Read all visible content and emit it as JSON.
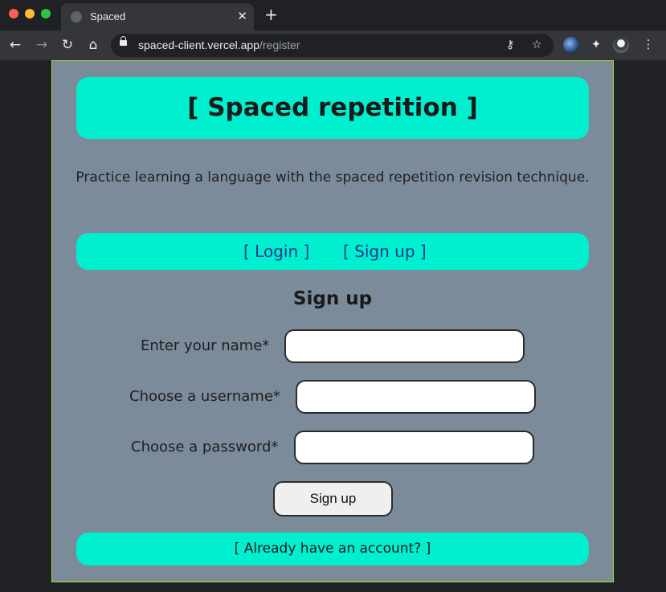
{
  "browser": {
    "tab_title": "Spaced",
    "tab_close": "✕",
    "new_tab": "+",
    "url_host": "spaced-client.vercel.app",
    "url_path": "/register",
    "icons": {
      "back": "←",
      "forward": "→",
      "reload": "↻",
      "home": "⌂",
      "key": "⚷",
      "star": "☆",
      "extensions": "✦",
      "menu": "⋮"
    }
  },
  "app": {
    "title": "[ Spaced repetition ]",
    "tagline": "Practice learning a language with the spaced repetition revision technique.",
    "nav": {
      "login": "[ Login ]",
      "signup": "[ Sign up ]"
    },
    "form": {
      "title": "Sign up",
      "name_label": "Enter your name*",
      "name_value": "",
      "username_label": "Choose a username*",
      "username_value": "",
      "password_label": "Choose a password*",
      "password_value": "",
      "submit_label": "Sign up"
    },
    "footer_link": "[ Already have an account? ]"
  },
  "colors": {
    "accent": "#00efce",
    "page_bg": "#7b8b99",
    "border": "#a6e22e"
  }
}
